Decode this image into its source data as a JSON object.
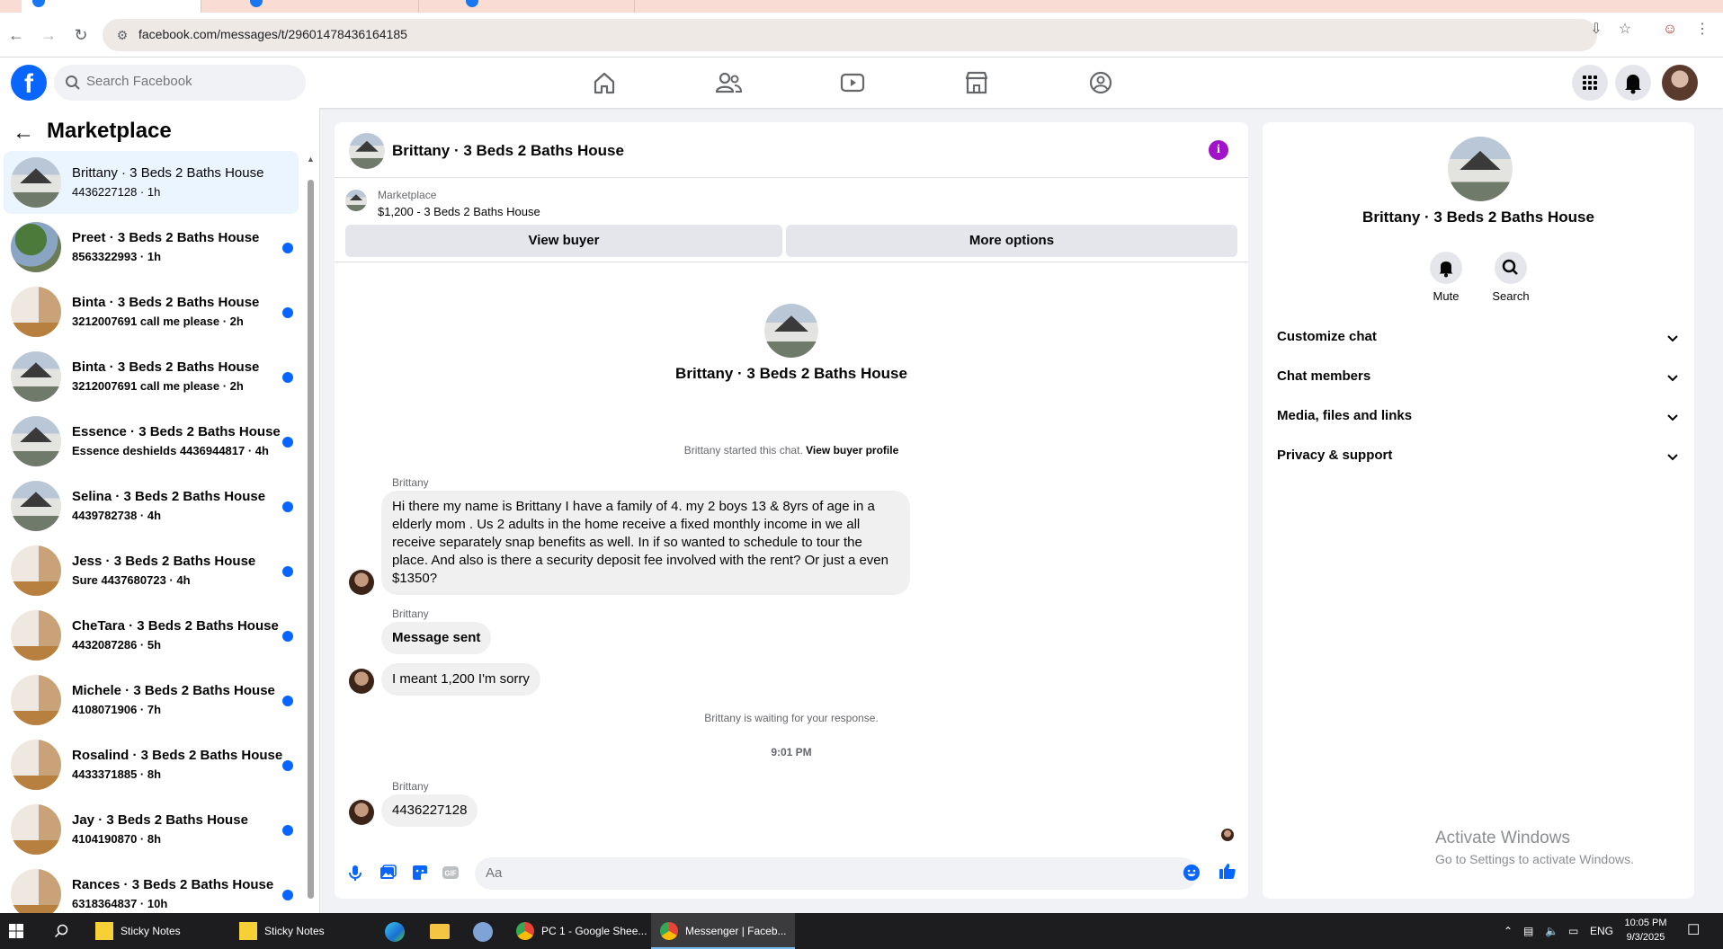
{
  "browser": {
    "url": "facebook.com/messages/t/29601478436164185"
  },
  "fb": {
    "search_placeholder": "Search Facebook"
  },
  "sidebar": {
    "title": "Marketplace",
    "conversations": [
      {
        "title": "Brittany · 3 Beds 2 Baths House",
        "sub": "4436227128 · 1h",
        "thumb": "house",
        "unread": false,
        "active": true
      },
      {
        "title": "Preet · 3 Beds 2 Baths House",
        "sub": "8563322993 · 1h",
        "thumb": "tree",
        "unread": true,
        "active": false
      },
      {
        "title": "Binta · 3 Beds 2 Baths House",
        "sub": "3212007691 call me please · 2h",
        "thumb": "interior",
        "unread": true,
        "active": false
      },
      {
        "title": "Binta · 3 Beds 2 Baths House",
        "sub": "3212007691 call me please · 2h",
        "thumb": "house",
        "unread": true,
        "active": false
      },
      {
        "title": "Essence · 3 Beds 2 Baths House",
        "sub": "Essence deshields 4436944817 · 4h",
        "thumb": "house",
        "unread": true,
        "active": false
      },
      {
        "title": "Selina · 3 Beds 2 Baths House",
        "sub": "4439782738 · 4h",
        "thumb": "house",
        "unread": true,
        "active": false
      },
      {
        "title": "Jess · 3 Beds 2 Baths House",
        "sub": "Sure 4437680723 · 4h",
        "thumb": "interior",
        "unread": true,
        "active": false
      },
      {
        "title": "CheTara · 3 Beds 2 Baths House",
        "sub": "4432087286 · 5h",
        "thumb": "interior",
        "unread": true,
        "active": false
      },
      {
        "title": "Michele · 3 Beds 2 Baths House",
        "sub": "4108071906 · 7h",
        "thumb": "interior",
        "unread": true,
        "active": false
      },
      {
        "title": "Rosalind · 3 Beds 2 Baths House",
        "sub": "4433371885 · 8h",
        "thumb": "interior",
        "unread": true,
        "active": false
      },
      {
        "title": "Jay · 3 Beds 2 Baths House",
        "sub": "4104190870 · 8h",
        "thumb": "interior",
        "unread": true,
        "active": false
      },
      {
        "title": "Rances · 3 Beds 2 Baths House",
        "sub": "6318364837 · 10h",
        "thumb": "interior",
        "unread": true,
        "active": false
      }
    ]
  },
  "chat": {
    "title": "Brittany · 3 Beds 2 Baths House",
    "listing_source": "Marketplace",
    "listing_price": "$1,200 - 3 Beds 2 Baths House",
    "view_buyer_label": "View buyer",
    "more_options_label": "More options",
    "intro_name": "Brittany · 3 Beds 2 Baths House",
    "started_text": "Brittany started this chat.",
    "view_buyer_profile": "View buyer profile",
    "sender_name": "Brittany",
    "message_1": "Hi there my name is Brittany I have a family of 4. my 2 boys 13 & 8yrs of age in a elderly mom . Us 2 adults in the home receive a fixed monthly income in we all receive separately snap benefits as well. In if so wanted to schedule to tour  the place. And also is there a security deposit fee involved with the rent? Or just a even $1350?",
    "message_2": "Message sent",
    "message_3": "I meant 1,200 I'm sorry",
    "waiting_text": "Brittany is waiting for your response.",
    "time_divider": "9:01 PM",
    "message_4": "4436227128",
    "composer_placeholder": "Aa"
  },
  "details": {
    "name": "Brittany · 3 Beds 2 Baths House",
    "mute_label": "Mute",
    "search_label": "Search",
    "rows": [
      "Customize chat",
      "Chat members",
      "Media, files and links",
      "Privacy & support"
    ]
  },
  "watermark": {
    "line1": "Activate Windows",
    "line2": "Go to Settings to activate Windows."
  },
  "taskbar": {
    "items": [
      "Sticky Notes",
      "Sticky Notes",
      "PC 1 - Google Shee...",
      "Messenger | Faceb..."
    ],
    "language": "ENG",
    "time": "10:05 PM",
    "date": "9/3/2025"
  },
  "colors": {
    "fb_blue": "#0866ff",
    "accent_purple": "#a112c8",
    "unread_dot": "#0866ff"
  }
}
